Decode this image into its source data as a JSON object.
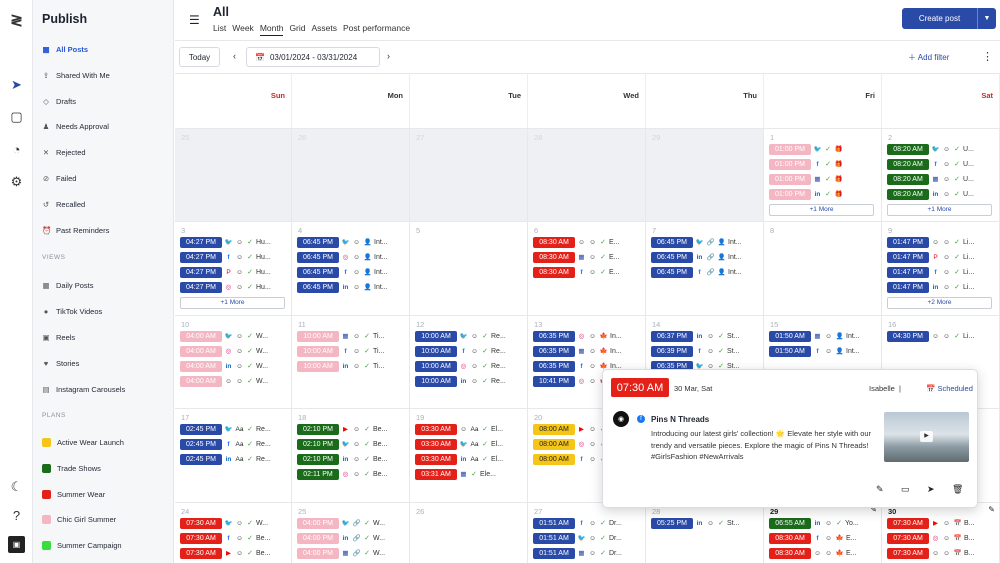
{
  "app": {
    "rail_icons": [
      "logo-icon",
      "send-icon",
      "inbox-icon",
      "analytics-icon",
      "settings-icon",
      "moon-icon",
      "help-icon",
      "profile-icon"
    ]
  },
  "sidebar": {
    "title": "Publish",
    "items": [
      {
        "label": "All Posts",
        "icon": "calendar-icon"
      },
      {
        "label": "Shared With Me",
        "icon": "share-icon"
      },
      {
        "label": "Drafts",
        "icon": "draft-icon"
      },
      {
        "label": "Needs Approval",
        "icon": "approval-icon"
      },
      {
        "label": "Rejected",
        "icon": "x-icon"
      },
      {
        "label": "Failed",
        "icon": "alert-icon"
      },
      {
        "label": "Recalled",
        "icon": "recall-icon"
      },
      {
        "label": "Past Reminders",
        "icon": "bell-icon"
      }
    ],
    "views_header": "VIEWS",
    "views": [
      {
        "label": "Daily Posts"
      },
      {
        "label": "TikTok Videos"
      },
      {
        "label": "Reels"
      },
      {
        "label": "Stories"
      },
      {
        "label": "Instagram Carousels"
      }
    ],
    "plans_header": "PLANS",
    "plans": [
      {
        "label": "Active Wear Launch",
        "color": "#f5c518"
      },
      {
        "label": "Trade Shows",
        "color": "#1a6b1a"
      },
      {
        "label": "Summer Wear",
        "color": "#e32119"
      },
      {
        "label": "Chic Girl Summer",
        "color": "#f4b6c2"
      },
      {
        "label": "Summer Campaign",
        "color": "#3ddc3d"
      }
    ]
  },
  "header": {
    "title": "All",
    "views": [
      "List",
      "Week",
      "Month",
      "Grid",
      "Assets",
      "Post performance"
    ],
    "active_view": "Month",
    "create_label": "Create post"
  },
  "toolbar": {
    "today": "Today",
    "prev": "‹",
    "next": "›",
    "range": "03/01/2024 - 03/31/2024",
    "add_filter": "Add filter",
    "more": "⋮"
  },
  "days": [
    "Sun",
    "Mon",
    "Tue",
    "Wed",
    "Thu",
    "Fri",
    "Sat"
  ],
  "calendar": [
    [
      {
        "d": "25",
        "off": true,
        "ev": []
      },
      {
        "d": "26",
        "off": true,
        "ev": []
      },
      {
        "d": "27",
        "off": true,
        "ev": []
      },
      {
        "d": "28",
        "off": true,
        "ev": []
      },
      {
        "d": "29",
        "off": true,
        "ev": []
      },
      {
        "d": "1",
        "ev": [
          {
            "t": "01:00 PM",
            "c": "#f4b6c2",
            "i": [
              "🐦",
              "✓",
              "🎁"
            ]
          },
          {
            "t": "01:00 PM",
            "c": "#f4b6c2",
            "i": [
              "f",
              "✓",
              "🎁"
            ]
          },
          {
            "t": "01:00 PM",
            "c": "#f4b6c2",
            "i": [
              "▦",
              "✓",
              "🎁"
            ]
          },
          {
            "t": "01:00 PM",
            "c": "#f4b6c2",
            "i": [
              "in",
              "✓",
              "🎁"
            ]
          }
        ],
        "more": "+1 More"
      },
      {
        "d": "2",
        "ev": [
          {
            "t": "08:20 AM",
            "c": "#1a6b1a",
            "i": [
              "🐦",
              "☺",
              "✓"
            ],
            "x": "U..."
          },
          {
            "t": "08:20 AM",
            "c": "#1a6b1a",
            "i": [
              "f",
              "☺",
              "✓"
            ],
            "x": "U..."
          },
          {
            "t": "08:20 AM",
            "c": "#1a6b1a",
            "i": [
              "▦",
              "☺",
              "✓"
            ],
            "x": "U..."
          },
          {
            "t": "08:20 AM",
            "c": "#1a6b1a",
            "i": [
              "in",
              "☺",
              "✓"
            ],
            "x": "U..."
          }
        ],
        "more": "+1 More"
      }
    ],
    [
      {
        "d": "3",
        "ev": [
          {
            "t": "04:27 PM",
            "c": "#2a4aa8",
            "i": [
              "🐦",
              "☺",
              "✓"
            ],
            "x": "Hu..."
          },
          {
            "t": "04:27 PM",
            "c": "#2a4aa8",
            "i": [
              "f",
              "☺",
              "✓"
            ],
            "x": "Hu..."
          },
          {
            "t": "04:27 PM",
            "c": "#2a4aa8",
            "i": [
              "P",
              "☺",
              "✓"
            ],
            "x": "Hu..."
          },
          {
            "t": "04:27 PM",
            "c": "#2a4aa8",
            "i": [
              "◎",
              "☺",
              "✓"
            ],
            "x": "Hu..."
          }
        ],
        "more": "+1 More"
      },
      {
        "d": "4",
        "ev": [
          {
            "t": "06:45 PM",
            "c": "#2a4aa8",
            "i": [
              "🐦",
              "☺",
              "👤"
            ],
            "x": "Int..."
          },
          {
            "t": "06:45 PM",
            "c": "#2a4aa8",
            "i": [
              "◎",
              "☺",
              "👤"
            ],
            "x": "Int..."
          },
          {
            "t": "06:45 PM",
            "c": "#2a4aa8",
            "i": [
              "f",
              "☺",
              "👤"
            ],
            "x": "Int..."
          },
          {
            "t": "06:45 PM",
            "c": "#2a4aa8",
            "i": [
              "in",
              "☺",
              "👤"
            ],
            "x": "Int..."
          }
        ]
      },
      {
        "d": "5",
        "ev": []
      },
      {
        "d": "6",
        "ev": [
          {
            "t": "08:30 AM",
            "c": "#e32119",
            "i": [
              "☺",
              "☺",
              "✓"
            ],
            "x": "E..."
          },
          {
            "t": "08:30 AM",
            "c": "#e32119",
            "i": [
              "▦",
              "☺",
              "✓"
            ],
            "x": "E..."
          },
          {
            "t": "08:30 AM",
            "c": "#e32119",
            "i": [
              "f",
              "☺",
              "✓"
            ],
            "x": "E..."
          }
        ]
      },
      {
        "d": "7",
        "ev": [
          {
            "t": "06:45 PM",
            "c": "#2a4aa8",
            "i": [
              "🐦",
              "🔗",
              "👤"
            ],
            "x": "Int..."
          },
          {
            "t": "06:45 PM",
            "c": "#2a4aa8",
            "i": [
              "in",
              "🔗",
              "👤"
            ],
            "x": "Int..."
          },
          {
            "t": "06:45 PM",
            "c": "#2a4aa8",
            "i": [
              "f",
              "🔗",
              "👤"
            ],
            "x": "Int..."
          }
        ]
      },
      {
        "d": "8",
        "ev": []
      },
      {
        "d": "9",
        "ev": [
          {
            "t": "01:47 PM",
            "c": "#2a4aa8",
            "i": [
              "☺",
              "☺",
              "✓"
            ],
            "x": "Li..."
          },
          {
            "t": "01:47 PM",
            "c": "#2a4aa8",
            "i": [
              "P",
              "☺",
              "✓"
            ],
            "x": "Li..."
          },
          {
            "t": "01:47 PM",
            "c": "#2a4aa8",
            "i": [
              "f",
              "☺",
              "✓"
            ],
            "x": "Li..."
          },
          {
            "t": "01:47 PM",
            "c": "#2a4aa8",
            "i": [
              "in",
              "☺",
              "✓"
            ],
            "x": "Li..."
          }
        ],
        "more": "+2 More"
      }
    ],
    [
      {
        "d": "10",
        "ev": [
          {
            "t": "04:00 AM",
            "c": "#f4b6c2",
            "i": [
              "🐦",
              "☺",
              "✓"
            ],
            "x": "W..."
          },
          {
            "t": "04:00 AM",
            "c": "#f4b6c2",
            "i": [
              "◎",
              "☺",
              "✓"
            ],
            "x": "W..."
          },
          {
            "t": "04:00 AM",
            "c": "#f4b6c2",
            "i": [
              "in",
              "☺",
              "✓"
            ],
            "x": "W..."
          },
          {
            "t": "04:00 AM",
            "c": "#f4b6c2",
            "i": [
              "☺",
              "☺",
              "✓"
            ],
            "x": "W..."
          }
        ]
      },
      {
        "d": "11",
        "ev": [
          {
            "t": "10:00 AM",
            "c": "#f4b6c2",
            "i": [
              "▦",
              "☺",
              "✓"
            ],
            "x": "Ti..."
          },
          {
            "t": "10:00 AM",
            "c": "#f4b6c2",
            "i": [
              "f",
              "☺",
              "✓"
            ],
            "x": "Ti..."
          },
          {
            "t": "10:00 AM",
            "c": "#f4b6c2",
            "i": [
              "in",
              "☺",
              "✓"
            ],
            "x": "Ti..."
          }
        ]
      },
      {
        "d": "12",
        "ev": [
          {
            "t": "10:00 AM",
            "c": "#2a4aa8",
            "i": [
              "🐦",
              "☺",
              "✓"
            ],
            "x": "Re..."
          },
          {
            "t": "10:00 AM",
            "c": "#2a4aa8",
            "i": [
              "f",
              "☺",
              "✓"
            ],
            "x": "Re..."
          },
          {
            "t": "10:00 AM",
            "c": "#2a4aa8",
            "i": [
              "◎",
              "☺",
              "✓"
            ],
            "x": "Re..."
          },
          {
            "t": "10:00 AM",
            "c": "#2a4aa8",
            "i": [
              "in",
              "☺",
              "✓"
            ],
            "x": "Re..."
          }
        ]
      },
      {
        "d": "13",
        "ev": [
          {
            "t": "06:35 PM",
            "c": "#2a4aa8",
            "i": [
              "◎",
              "☺",
              "🍁"
            ],
            "x": "In..."
          },
          {
            "t": "06:35 PM",
            "c": "#2a4aa8",
            "i": [
              "▦",
              "☺",
              "🍁"
            ],
            "x": "In..."
          },
          {
            "t": "06:35 PM",
            "c": "#2a4aa8",
            "i": [
              "f",
              "☺",
              "🍁"
            ],
            "x": "In..."
          },
          {
            "t": "10:41 PM",
            "c": "#2a4aa8",
            "i": [
              "◎",
              "☺",
              "🍁"
            ],
            "x": "In..."
          }
        ]
      },
      {
        "d": "14",
        "ev": [
          {
            "t": "06:37 PM",
            "c": "#2a4aa8",
            "i": [
              "in",
              "☺",
              "✓"
            ],
            "x": "St..."
          },
          {
            "t": "06:39 PM",
            "c": "#2a4aa8",
            "i": [
              "f",
              "☺",
              "✓"
            ],
            "x": "St..."
          },
          {
            "t": "06:35 PM",
            "c": "#2a4aa8",
            "i": [
              "🐦",
              "☺",
              "✓"
            ],
            "x": "St..."
          }
        ]
      },
      {
        "d": "15",
        "ev": [
          {
            "t": "01:50 AM",
            "c": "#2a4aa8",
            "i": [
              "▦",
              "☺",
              "👤"
            ],
            "x": "Int..."
          },
          {
            "t": "01:50 AM",
            "c": "#2a4aa8",
            "i": [
              "f",
              "☺",
              "👤"
            ],
            "x": "Int..."
          }
        ]
      },
      {
        "d": "16",
        "ev": [
          {
            "t": "04:30 PM",
            "c": "#2a4aa8",
            "i": [
              "☺",
              "☺",
              "✓"
            ],
            "x": "Li..."
          }
        ]
      }
    ],
    [
      {
        "d": "17",
        "ev": [
          {
            "t": "02:45 PM",
            "c": "#2a4aa8",
            "i": [
              "🐦",
              "Aa",
              "✓"
            ],
            "x": "Re..."
          },
          {
            "t": "02:45 PM",
            "c": "#2a4aa8",
            "i": [
              "f",
              "Aa",
              "✓"
            ],
            "x": "Re..."
          },
          {
            "t": "02:45 PM",
            "c": "#2a4aa8",
            "i": [
              "in",
              "Aa",
              "✓"
            ],
            "x": "Re..."
          }
        ]
      },
      {
        "d": "18",
        "ev": [
          {
            "t": "02:10 PM",
            "c": "#1a6b1a",
            "i": [
              "▶",
              "☺",
              "✓"
            ],
            "x": "Be..."
          },
          {
            "t": "02:10 PM",
            "c": "#1a6b1a",
            "i": [
              "🐦",
              "☺",
              "✓"
            ],
            "x": "Be..."
          },
          {
            "t": "02:10 PM",
            "c": "#1a6b1a",
            "i": [
              "in",
              "☺",
              "✓"
            ],
            "x": "Be..."
          },
          {
            "t": "02:11 PM",
            "c": "#1a6b1a",
            "i": [
              "◎",
              "☺",
              "✓"
            ],
            "x": "Be..."
          }
        ]
      },
      {
        "d": "19",
        "ev": [
          {
            "t": "03:30 AM",
            "c": "#e32119",
            "i": [
              "☺",
              "Aa",
              "✓"
            ],
            "x": "El..."
          },
          {
            "t": "03:30 AM",
            "c": "#e32119",
            "i": [
              "🐦",
              "Aa",
              "✓"
            ],
            "x": "El..."
          },
          {
            "t": "03:30 AM",
            "c": "#e32119",
            "i": [
              "in",
              "Aa",
              "✓"
            ],
            "x": "El..."
          },
          {
            "t": "03:31 AM",
            "c": "#e32119",
            "i": [
              "▦",
              "✓",
              ""
            ],
            "x": "Ele..."
          }
        ]
      },
      {
        "d": "20",
        "ev": [
          {
            "t": "08:00 AM",
            "c": "#f5c518",
            "dark": true,
            "i": [
              "▶",
              "☺",
              "✓"
            ],
            "x": "Be..."
          },
          {
            "t": "08:00 AM",
            "c": "#f5c518",
            "dark": true,
            "i": [
              "◎",
              "☺",
              "✓"
            ],
            "x": "Be..."
          },
          {
            "t": "08:00 AM",
            "c": "#f5c518",
            "dark": true,
            "i": [
              "f",
              "☺",
              "✓"
            ],
            "x": "Be..."
          }
        ]
      },
      {
        "d": "21",
        "ev": []
      },
      {
        "d": "22",
        "ev": []
      },
      {
        "d": "23",
        "ev": []
      }
    ],
    [
      {
        "d": "24",
        "ev": [
          {
            "t": "07:30 AM",
            "c": "#e32119",
            "i": [
              "🐦",
              "☺",
              "✓"
            ],
            "x": "W..."
          },
          {
            "t": "07:30 AM",
            "c": "#e32119",
            "i": [
              "f",
              "☺",
              "✓"
            ],
            "x": "Be..."
          },
          {
            "t": "07:30 AM",
            "c": "#e32119",
            "i": [
              "▶",
              "☺",
              "✓"
            ],
            "x": "Be..."
          }
        ]
      },
      {
        "d": "25",
        "ev": [
          {
            "t": "04:00 PM",
            "c": "#f4b6c2",
            "i": [
              "🐦",
              "🔗",
              "✓"
            ],
            "x": "W..."
          },
          {
            "t": "04:00 PM",
            "c": "#f4b6c2",
            "i": [
              "in",
              "🔗",
              "✓"
            ],
            "x": "W..."
          },
          {
            "t": "04:00 PM",
            "c": "#f4b6c2",
            "i": [
              "▦",
              "🔗",
              "✓"
            ],
            "x": "W..."
          }
        ]
      },
      {
        "d": "26",
        "ev": []
      },
      {
        "d": "27",
        "ev": [
          {
            "t": "01:51 AM",
            "c": "#2a4aa8",
            "i": [
              "f",
              "☺",
              "✓"
            ],
            "x": "Dr..."
          },
          {
            "t": "01:51 AM",
            "c": "#2a4aa8",
            "i": [
              "🐦",
              "☺",
              "✓"
            ],
            "x": "Dr..."
          },
          {
            "t": "01:51 AM",
            "c": "#2a4aa8",
            "i": [
              "▦",
              "☺",
              "✓"
            ],
            "x": "Dr..."
          }
        ]
      },
      {
        "d": "28",
        "ev": [
          {
            "t": "05:25 PM",
            "c": "#2a4aa8",
            "i": [
              "in",
              "☺",
              "✓"
            ],
            "x": "St..."
          }
        ]
      },
      {
        "d": "29",
        "bold": true,
        "ev": [
          {
            "t": "06:55 AM",
            "c": "#1a6b1a",
            "i": [
              "in",
              "☺",
              "✓"
            ],
            "x": "Yo..."
          },
          {
            "t": "08:30 AM",
            "c": "#e32119",
            "i": [
              "f",
              "☺",
              "🍁"
            ],
            "x": "E..."
          },
          {
            "t": "08:30 AM",
            "c": "#e32119",
            "i": [
              "☺",
              "☺",
              "🍁"
            ],
            "x": "E..."
          }
        ]
      },
      {
        "d": "30",
        "bold": true,
        "ev": [
          {
            "t": "07:30 AM",
            "c": "#e32119",
            "i": [
              "▶",
              "☺",
              "📅"
            ],
            "x": "B..."
          },
          {
            "t": "07:30 AM",
            "c": "#e32119",
            "i": [
              "◎",
              "☺",
              "📅"
            ],
            "x": "B..."
          },
          {
            "t": "07:30 AM",
            "c": "#e32119",
            "i": [
              "☺",
              "☺",
              "📅"
            ],
            "x": "B..."
          }
        ]
      }
    ]
  ],
  "popup": {
    "time": "07:30 AM",
    "date": "30 Mar, Sat",
    "user": "Isabelle",
    "separator": "|",
    "status": "Scheduled",
    "account": "Pins N Threads",
    "body": "Introducing our latest girls' collection! 🌟 Elevate her style with our trendy and versatile pieces. Explore the magic of Pins N Threads! #GirlsFashion #NewArrivals"
  }
}
